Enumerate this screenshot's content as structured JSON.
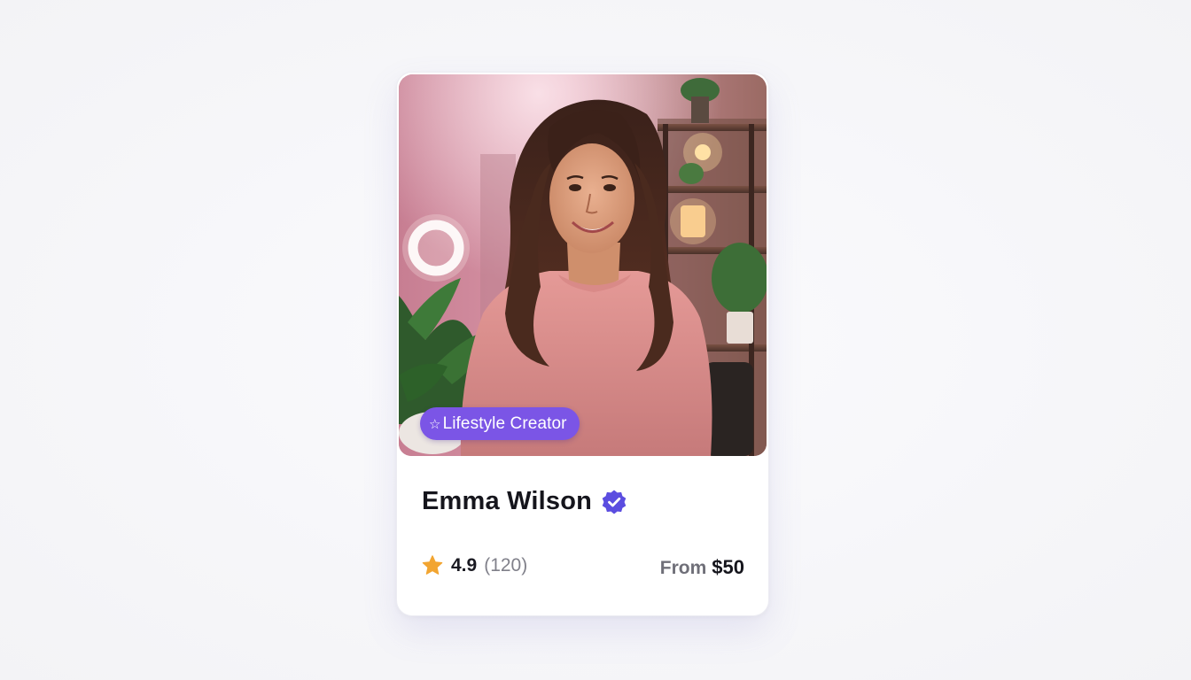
{
  "card": {
    "category_badge": {
      "icon": "star-outline-icon",
      "label": "Lifestyle Creator",
      "color": "#7b55e6"
    },
    "creator_name": "Emma Wilson",
    "verified_icon": "verified-check-icon",
    "verified_color": "#5b4de0",
    "rating": {
      "icon": "star-icon",
      "icon_color": "#f2a531",
      "value": "4.9",
      "count": "(120)"
    },
    "price": {
      "prefix": "From",
      "value": "$50"
    }
  }
}
